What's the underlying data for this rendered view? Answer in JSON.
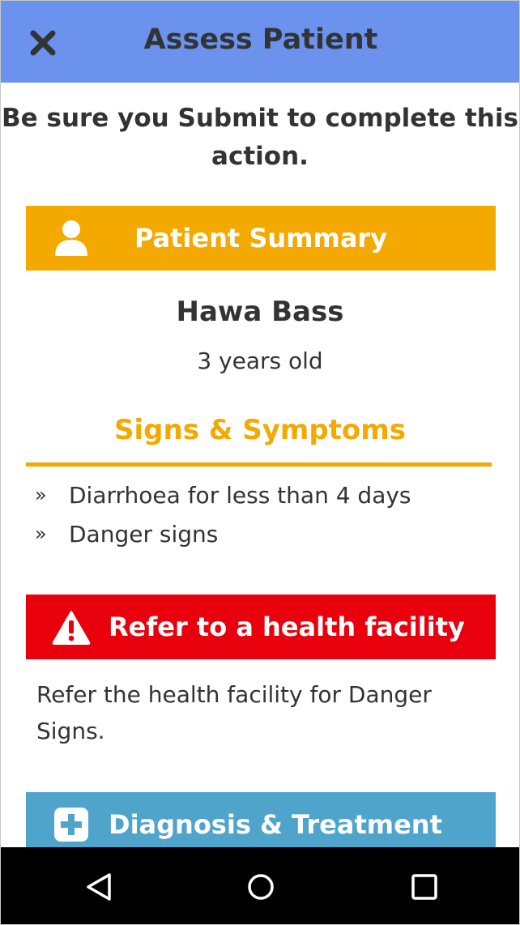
{
  "header": {
    "title": "Assess Patient",
    "close_icon": "close-icon",
    "background": "#6b93ee"
  },
  "warning_message": "Be sure you Submit to complete this action.",
  "patient_summary": {
    "label": "Patient Summary",
    "icon": "person-icon",
    "color": "#f3a900",
    "name": "Hawa Bass",
    "age": "3 years old"
  },
  "signs": {
    "title": "Signs & Symptoms",
    "bullet": "»",
    "items": [
      "Diarrhoea for less than 4 days",
      "Danger signs"
    ]
  },
  "refer": {
    "label": "Refer to a health facility",
    "icon": "warning-icon",
    "color": "#e8000d",
    "text": "Refer the health facility for Danger Signs."
  },
  "diagnosis": {
    "label": "Diagnosis & Treatment",
    "icon": "medical-plus-icon",
    "color": "#4fa4cc"
  },
  "navbar": {
    "back_icon": "back-triangle-icon",
    "home_icon": "home-circle-icon",
    "recent_icon": "recent-apps-square-icon"
  }
}
